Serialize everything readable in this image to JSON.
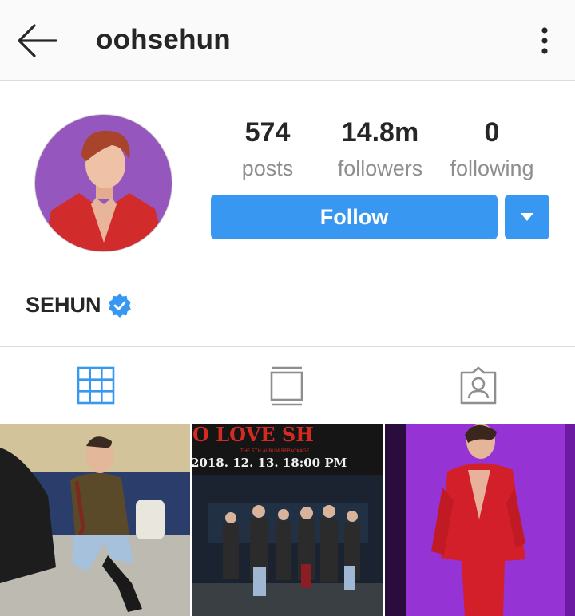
{
  "header": {
    "username": "oohsehun",
    "back_icon": "arrow-left-icon",
    "more_icon": "more-vertical-icon"
  },
  "profile": {
    "avatar_icon": "avatar",
    "stats": [
      {
        "value": "574",
        "label": "posts"
      },
      {
        "value": "14.8m",
        "label": "followers"
      },
      {
        "value": "0",
        "label": "following"
      }
    ],
    "follow_label": "Follow",
    "dropdown_icon": "caret-down-icon",
    "display_name": "SEHUN",
    "verified": true
  },
  "tabs": [
    {
      "icon": "grid-icon",
      "selected": true
    },
    {
      "icon": "feed-icon",
      "selected": false
    },
    {
      "icon": "tagged-icon",
      "selected": false
    }
  ],
  "posts": [
    {
      "kind": "photo"
    },
    {
      "kind": "poster",
      "headline": "O LOVE SH",
      "subtitle": "THE 5TH ALBUM REPACKAGE",
      "date_text": "2018. 12. 13. 18:00 PM"
    },
    {
      "kind": "photo"
    }
  ],
  "colors": {
    "accent": "#3897f0",
    "text": "#262626",
    "muted": "#8e8e8e",
    "header_bg": "#fafafa",
    "divider": "#dbdbdb",
    "poster_red": "#d42a22"
  }
}
